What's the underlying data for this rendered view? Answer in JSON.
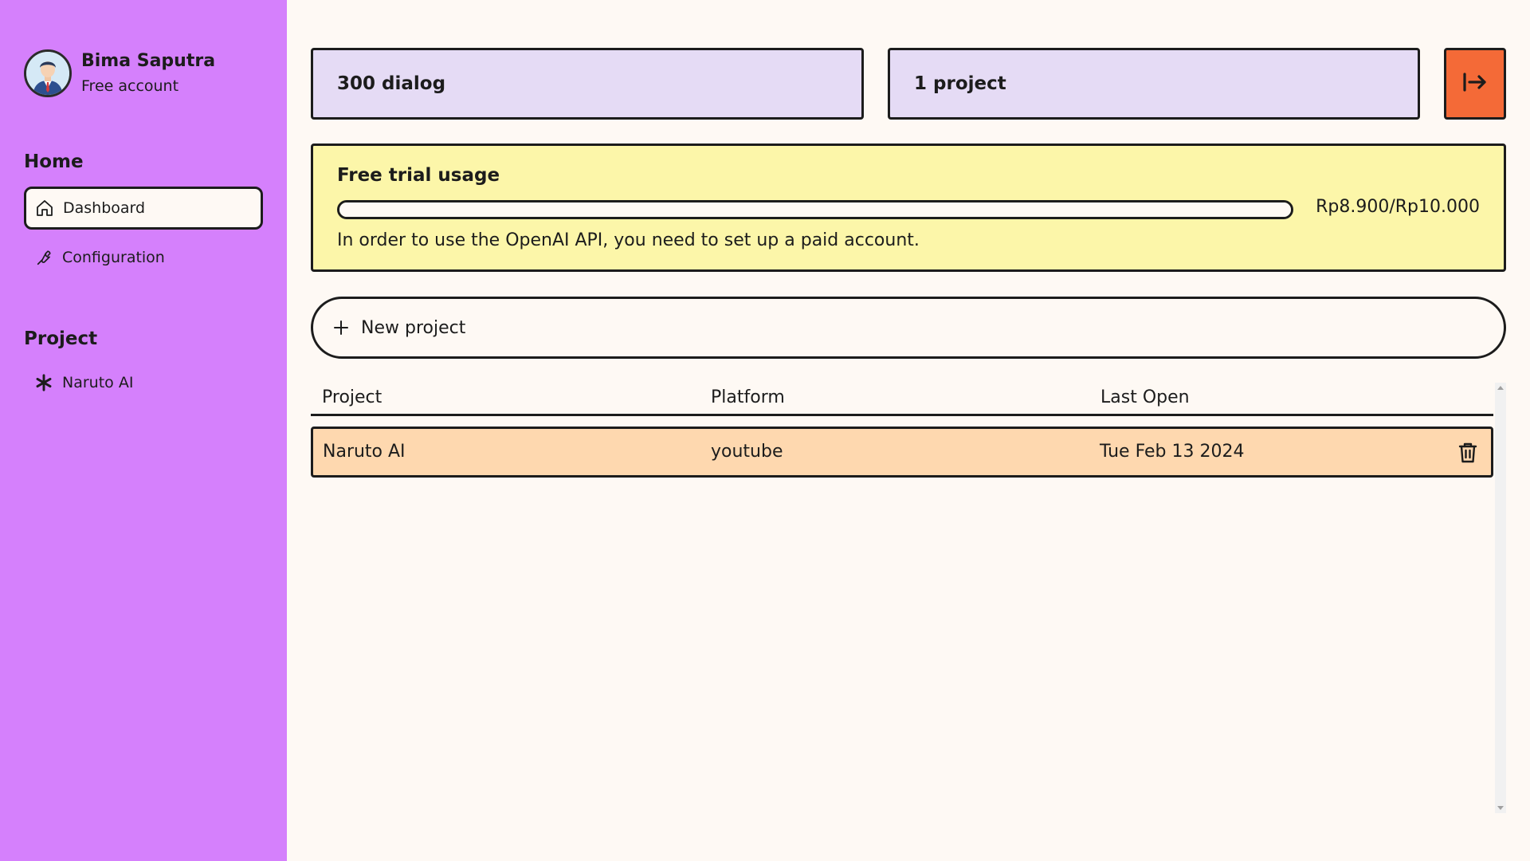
{
  "user": {
    "name": "Bima Saputra",
    "plan": "Free account"
  },
  "sidebar": {
    "home_title": "Home",
    "home_items": [
      {
        "label": "Dashboard",
        "icon": "home-icon",
        "active": true
      },
      {
        "label": "Configuration",
        "icon": "wrench-icon",
        "active": false
      }
    ],
    "project_title": "Project",
    "project_items": [
      {
        "label": "Naruto AI",
        "icon": "asterisk-icon"
      }
    ]
  },
  "stats": {
    "dialog": "300 dialog",
    "projects": "1 project"
  },
  "trial": {
    "title": "Free trial usage",
    "amount": "Rp8.900/Rp10.000",
    "note": "In order to use the OpenAI API, you need to set up a paid account."
  },
  "new_project": {
    "label": "New project"
  },
  "table": {
    "headers": [
      "Project",
      "Platform",
      "Last Open"
    ],
    "rows": [
      {
        "project": "Naruto AI",
        "platform": "youtube",
        "last_open": "Tue Feb 13 2024"
      }
    ]
  },
  "colors": {
    "sidebar": "#d580fc",
    "background": "#fef9f4",
    "stat_card": "#e5dbf5",
    "trial_card": "#fcf6a9",
    "row": "#fed8af",
    "logout": "#f46a37"
  }
}
